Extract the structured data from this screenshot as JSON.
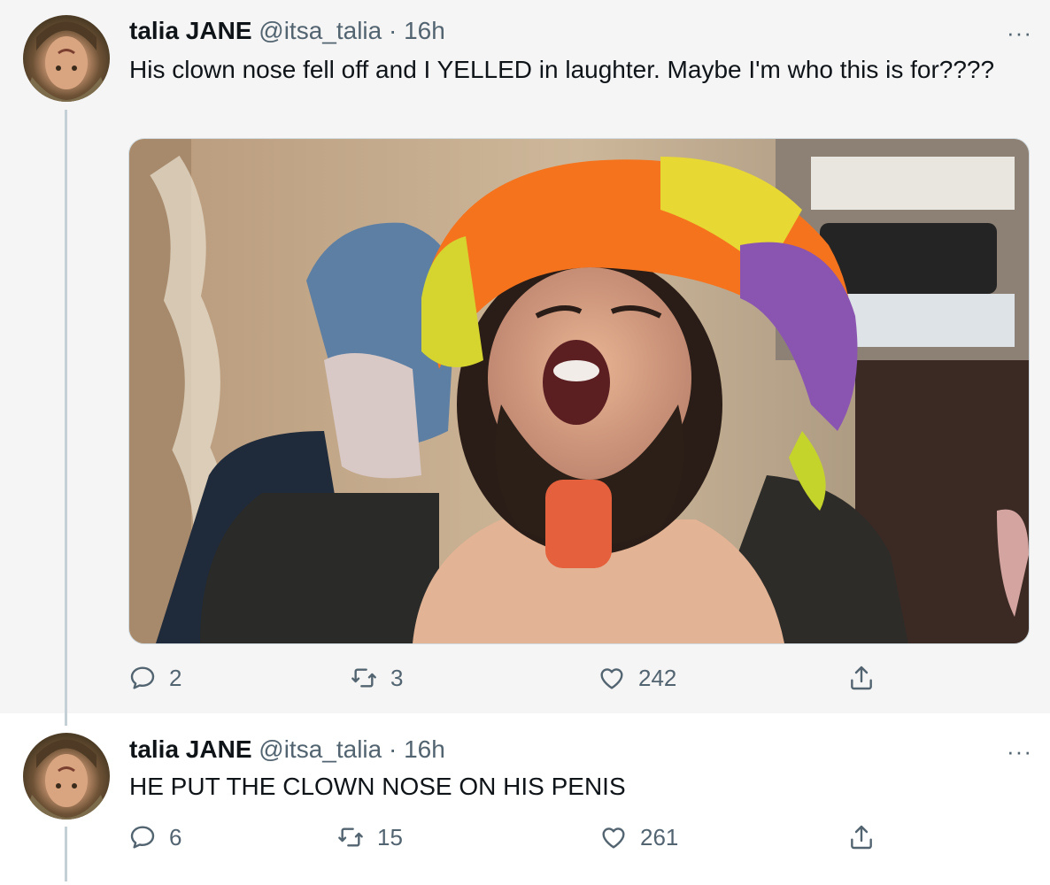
{
  "tweets": [
    {
      "name": "talia JANE",
      "handle": "@itsa_talia",
      "dot": "·",
      "time": "16h",
      "text": "His clown nose fell off and I YELLED in laughter. Maybe I'm who this is for????",
      "replies": "2",
      "retweets": "3",
      "likes": "242",
      "more": "···"
    },
    {
      "name": "talia JANE",
      "handle": "@itsa_talia",
      "dot": "·",
      "time": "16h",
      "text": "HE PUT THE CLOWN NOSE ON HIS PENIS",
      "replies": "6",
      "retweets": "15",
      "likes": "261",
      "more": "···"
    }
  ],
  "icons": [
    "reply-icon",
    "retweet-icon",
    "like-icon",
    "share-icon",
    "more-icon"
  ],
  "colors": {
    "secondary_text": "#536471",
    "thread_line": "#c4cfd6"
  }
}
